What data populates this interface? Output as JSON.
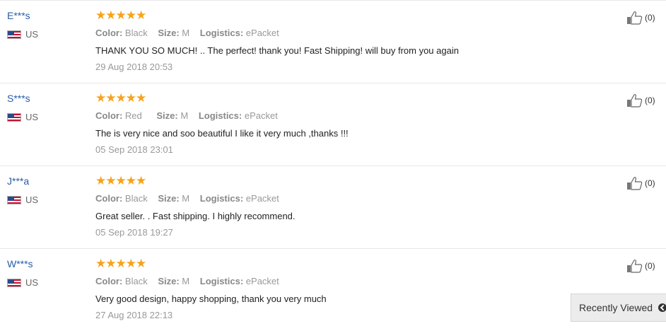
{
  "reviews": [
    {
      "user": "E***s",
      "country": "US",
      "stars": "★★★★★",
      "color_label": "Color:",
      "color": "Black",
      "size_label": "Size:",
      "size": "M",
      "logistics_label": "Logistics:",
      "logistics": "ePacket",
      "feedback": "THANK YOU SO MUCH! .. The perfect! thank you! Fast Shipping! will buy from you again",
      "date": "29 Aug 2018 20:53",
      "helpful_count": "(0)"
    },
    {
      "user": "S***s",
      "country": "US",
      "stars": "★★★★★",
      "color_label": "Color:",
      "color": "Red",
      "size_label": "Size:",
      "size": "M",
      "logistics_label": "Logistics:",
      "logistics": "ePacket",
      "feedback": "The is very nice and soo beautiful I like it very much ,thanks !!!",
      "date": "05 Sep 2018 23:01",
      "helpful_count": "(0)"
    },
    {
      "user": "J***a",
      "country": "US",
      "stars": "★★★★★",
      "color_label": "Color:",
      "color": "Black",
      "size_label": "Size:",
      "size": "M",
      "logistics_label": "Logistics:",
      "logistics": "ePacket",
      "feedback": "Great seller. . Fast shipping. I highly recommend.",
      "date": "05 Sep 2018 19:27",
      "helpful_count": "(0)"
    },
    {
      "user": "W***s",
      "country": "US",
      "stars": "★★★★★",
      "color_label": "Color:",
      "color": "Black",
      "size_label": "Size:",
      "size": "M",
      "logistics_label": "Logistics:",
      "logistics": "ePacket",
      "feedback": "Very good design, happy shopping, thank you very much",
      "date": "27 Aug 2018 22:13",
      "helpful_count": "(0)"
    }
  ],
  "recently_viewed": {
    "label": "Recently Viewed",
    "icon": "chevron-circle-icon"
  },
  "colors": {
    "star": "#f6a31b",
    "username": "#2a5ca8",
    "muted": "#999999"
  },
  "icons": {
    "helpful": "thumbs-up-icon",
    "flag": "us-flag-icon"
  }
}
